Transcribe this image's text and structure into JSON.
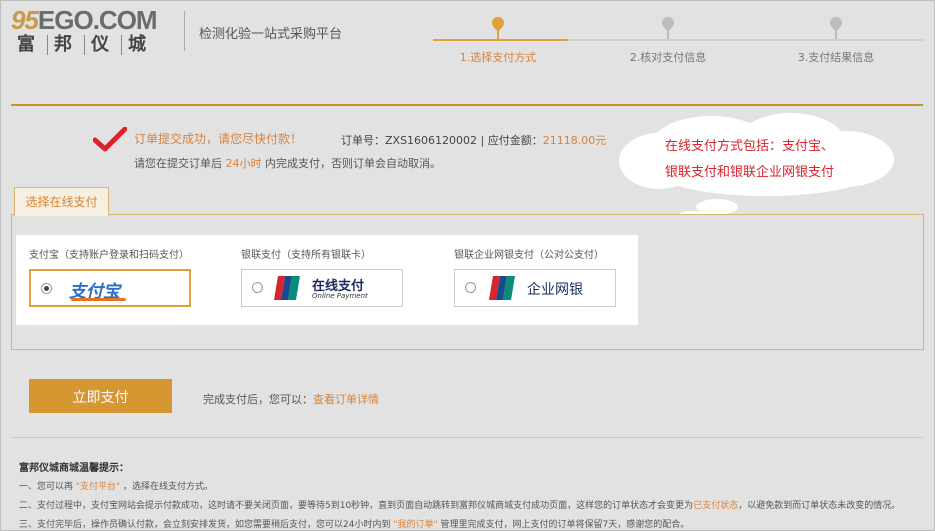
{
  "header": {
    "logo_prefix": "95",
    "logo_brand": "EGO.COM",
    "logo_cn": [
      "富",
      "邦",
      "仪",
      "城"
    ],
    "platform": "检测化验一站式采购平台"
  },
  "steps": [
    {
      "label": "1.选择支付方式",
      "active": true
    },
    {
      "label": "2.核对支付信息",
      "active": false
    },
    {
      "label": "3.支付结果信息",
      "active": false
    }
  ],
  "status": {
    "title": "订单提交成功，请您尽快付款！",
    "order_label": "订单号：",
    "order_no": "ZXS1606120002",
    "amount_label": " | 应付金额：",
    "amount": "21118.00元",
    "note_pre": "请您在提交订单后 ",
    "note_time": "24小时",
    "note_post": " 内完成支付，否则订单会自动取消。"
  },
  "callout": {
    "line1": "在线支付方式包括：支付宝、",
    "line2": "银联支付和银联企业网银支付"
  },
  "payment": {
    "tab_label": "选择在线支付",
    "options": [
      {
        "title": "支付宝（支持账户登录和扫码支付）",
        "logo_text": "支付宝",
        "selected": true
      },
      {
        "title": "银联支付（支持所有银联卡）",
        "logo_text": "在线支付",
        "logo_sub": "Online Payment",
        "selected": false
      },
      {
        "title": "银联企业网银支付（公对公支付）",
        "logo_text": "企业网银",
        "selected": false
      }
    ],
    "unionpay_mark": "UnionPay 银联"
  },
  "actions": {
    "pay_label": "立即支付",
    "after_text": "完成支付后，您可以：",
    "view_order_link": "查看订单详情"
  },
  "tips": {
    "title": "富邦仪城商城温馨提示：",
    "t1_pre": "一、您可以再 ",
    "t1_hl": "\"支付平台\"",
    "t1_post": " ，选择在线支付方式。",
    "t2_pre": "二、支付过程中，支付宝网站会提示付款成功，这时请不要关闭页面，要等待5到10秒钟，直到页面自动跳转到富邦仪城商城支付成功页面，这样您的订单状态才会变更为",
    "t2_hl": "已支付状态",
    "t2_post": "，以避免款到而订单状态未改变的情况。",
    "t3_pre": "三、支付完毕后，操作员确认付款，会立刻安排发货，如您需要稍后支付，您可以24小时内到 ",
    "t3_hl": "\"我的订单\"",
    "t3_post": " 管理里完成支付，网上支付的订单将保留7天，感谢您的配合。"
  },
  "colors": {
    "accent": "#d69632",
    "highlight_text": "#d9823a",
    "callout_text": "#d8242c"
  }
}
